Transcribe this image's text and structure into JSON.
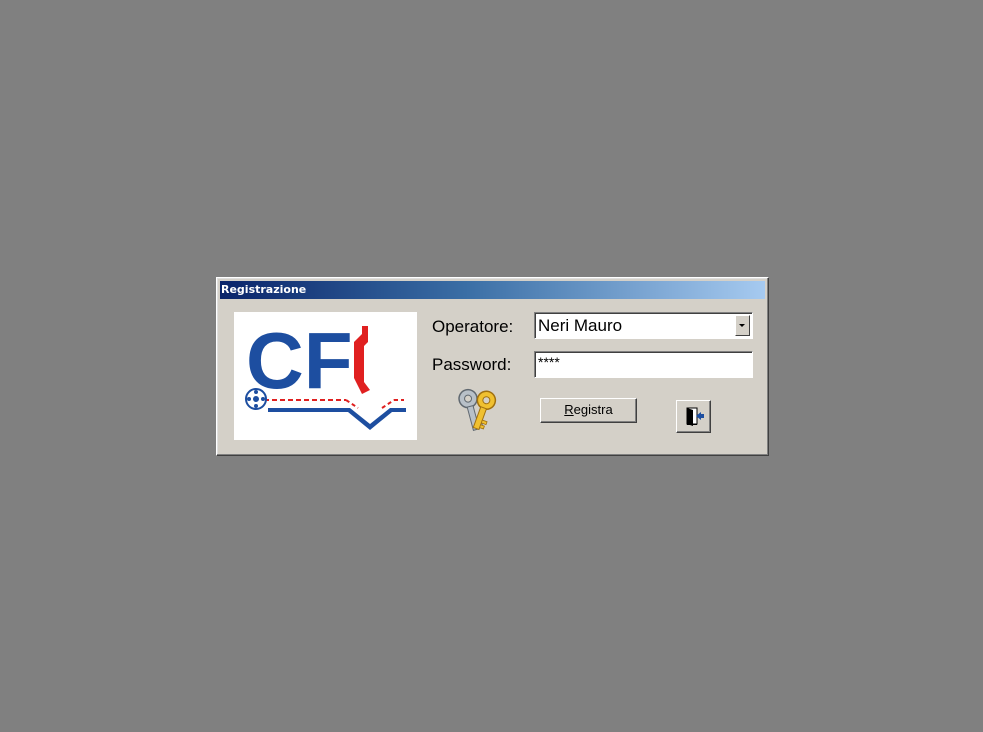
{
  "window": {
    "title": "Registrazione"
  },
  "logo": {
    "text": "CF",
    "icon": "company-logo",
    "colors": {
      "blue": "#1d4ea0",
      "red": "#e02020"
    }
  },
  "form": {
    "operator_label": "Operatore:",
    "operator_value": "Neri Mauro",
    "password_label": "Password:",
    "password_value": "****"
  },
  "buttons": {
    "registra_label": "Registra",
    "registra_accel": "R",
    "registra_rest": "egistra",
    "exit_icon": "exit-door-icon"
  },
  "icons": {
    "keys": "keys-icon"
  }
}
